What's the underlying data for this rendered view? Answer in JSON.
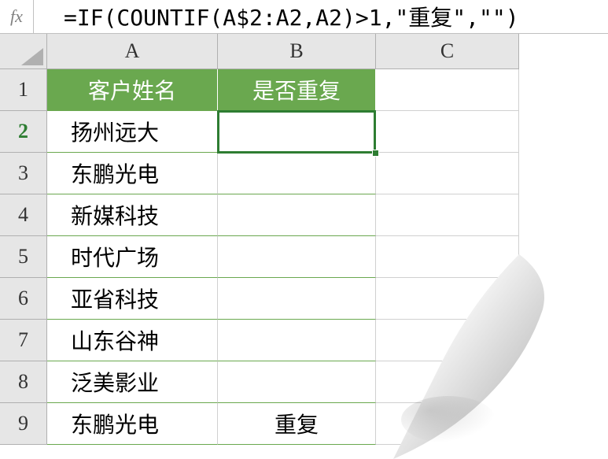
{
  "formulaBar": {
    "fxLabel": "fx",
    "formula": "=IF(COUNTIF(A$2:A2,A2)>1,\"重复\",\"\")"
  },
  "columns": {
    "A": "A",
    "B": "B",
    "C": "C"
  },
  "rows": {
    "r1": "1",
    "r2": "2",
    "r3": "3",
    "r4": "4",
    "r5": "5",
    "r6": "6",
    "r7": "7",
    "r8": "8",
    "r9": "9"
  },
  "headers": {
    "A": "客户姓名",
    "B": "是否重复"
  },
  "data": {
    "A2": "扬州远大",
    "A3": "东鹏光电",
    "A4": "新媒科技",
    "A5": "时代广场",
    "A6": "亚省科技",
    "A7": "山东谷神",
    "A8": "泛美影业",
    "A9": "东鹏光电",
    "B2": "",
    "B3": "",
    "B4": "",
    "B5": "",
    "B6": "",
    "B7": "",
    "B8": "",
    "B9": "重复"
  },
  "activeCell": "B2"
}
